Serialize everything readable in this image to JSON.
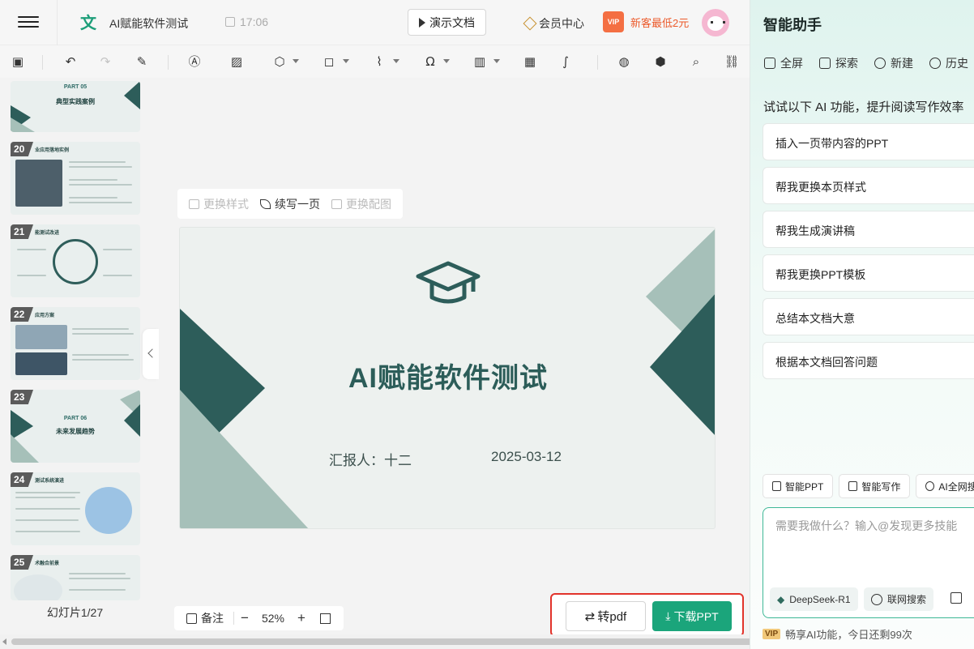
{
  "header": {
    "doc_icon": "文",
    "doc_title": "AI赋能软件测试",
    "save_time": "17:06",
    "present_label": "演示文档",
    "member_label": "会员中心",
    "vip_badge": "VIP",
    "vip_promo": "新客最低2元"
  },
  "toolbar": {
    "items": [
      "save-icon",
      "undo-icon",
      "redo-icon",
      "format-brush-icon",
      "textbox-icon",
      "image-icon",
      "shape-icon",
      "chart-icon",
      "flowchart-icon",
      "symbol-icon",
      "bar-chart-icon",
      "table-icon",
      "formula-icon",
      "theme-icon",
      "settings-icon",
      "search-icon",
      "link-icon"
    ]
  },
  "sidebar": {
    "thumbnails": [
      {
        "num": "",
        "part": "PART 05",
        "title": "典型实践案例",
        "head": ""
      },
      {
        "num": "20",
        "part": "",
        "title": "",
        "head": "业应用落地实例"
      },
      {
        "num": "21",
        "part": "",
        "title": "",
        "head": "能测试改进"
      },
      {
        "num": "22",
        "part": "",
        "title": "",
        "head": "应用方案"
      },
      {
        "num": "23",
        "part": "PART 06",
        "title": "未来发展趋势",
        "head": ""
      },
      {
        "num": "24",
        "part": "",
        "title": "",
        "head": "测试系统演进"
      },
      {
        "num": "25",
        "part": "",
        "title": "",
        "head": "术融合前景"
      }
    ],
    "slide_count": "幻灯片1/27"
  },
  "float_toolbar": {
    "change_style": "更换样式",
    "continue_write": "续写一页",
    "change_image": "更换配图"
  },
  "slide": {
    "title": "AI赋能软件测试",
    "reporter": "汇报人：十二",
    "date": "2025-03-12",
    "colors": {
      "dark": "#2d5d5a",
      "light": "#a6c0b9",
      "bg": "#edf1ef"
    }
  },
  "bottom": {
    "notes_label": "备注",
    "zoom_minus": "−",
    "zoom_value": "52%",
    "zoom_plus": "+",
    "to_pdf": "转pdf",
    "download_ppt": "下载PPT"
  },
  "ai_panel": {
    "title": "智能助手",
    "tabs": [
      "全屏",
      "探索",
      "新建",
      "历史"
    ],
    "prompt": "试试以下 AI 功能，提升阅读写作效率",
    "suggestions": [
      "插入一页带内容的PPT",
      "帮我更换本页样式",
      "帮我生成演讲稿",
      "帮我更换PPT模板",
      "总结本文档大意",
      "根据本文档回答问题"
    ],
    "chips": [
      "智能PPT",
      "智能写作",
      "AI全网搜索"
    ],
    "input_placeholder": "需要我做什么？输入@发现更多技能",
    "model": "DeepSeek-R1",
    "web_search": "联网搜索",
    "vip_tag": "VIP",
    "vip_text": "畅享AI功能，今日还剩99次"
  }
}
